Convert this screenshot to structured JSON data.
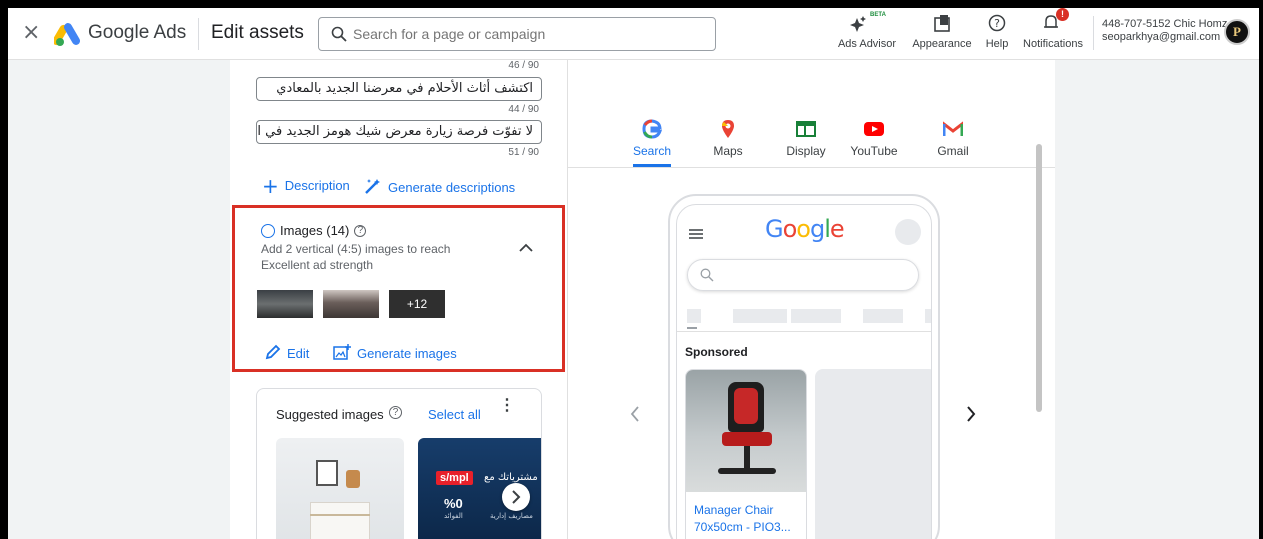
{
  "header": {
    "close_glyph": "×",
    "brand": "Google Ads",
    "page_title": "Edit assets",
    "search_placeholder": "Search for a page or campaign",
    "tools": [
      {
        "label": "Ads Advisor",
        "badge": "BETA",
        "icon": "sparkle-icon"
      },
      {
        "label": "Appearance",
        "icon": "appearance-icon"
      },
      {
        "label": "Help",
        "icon": "help-icon"
      },
      {
        "label": "Notifications",
        "badge": "!",
        "icon": "bell-icon"
      }
    ],
    "account_line1": "448-707-5152 Chic Homz",
    "account_line2": "seoparkhya@gmail.com",
    "avatar_letter": "P"
  },
  "editor": {
    "counter_top": "46 / 90",
    "descriptions": [
      {
        "value": "اكتشف أثاث الأحلام في معرضنا الجديد بالمعادي",
        "count": "44 / 90"
      },
      {
        "value": "لا تفوّت فرصة زيارة معرض شيك هومز الجديد في المعادي",
        "count": "51 / 90"
      }
    ],
    "add_description_label": "Description",
    "generate_descriptions_label": "Generate descriptions",
    "images": {
      "title": "Images (14)",
      "hint_line1": "Add 2 vertical (4:5) images to reach",
      "hint_line2": "Excellent ad strength",
      "more_count": "+12",
      "edit_label": "Edit",
      "generate_label": "Generate images"
    },
    "suggested": {
      "title": "Suggested images",
      "select_all": "Select all",
      "promo_brand": "s/mpl",
      "promo_text": "سم مشترياتك مع",
      "promo_percent": "%0",
      "promo_sub1": "الفوائد",
      "promo_sub2": "مصاريف إدارية"
    }
  },
  "preview": {
    "tabs": [
      {
        "label": "Search",
        "active": true
      },
      {
        "label": "Maps"
      },
      {
        "label": "Display"
      },
      {
        "label": "YouTube"
      },
      {
        "label": "Gmail"
      }
    ],
    "google_logo": "Google",
    "sponsored": "Sponsored",
    "product_title_line1": "Manager Chair",
    "product_title_line2": "70x50cm - PIO3..."
  },
  "colors": {
    "accent": "#1a73e8",
    "highlight_border": "#d93025"
  }
}
